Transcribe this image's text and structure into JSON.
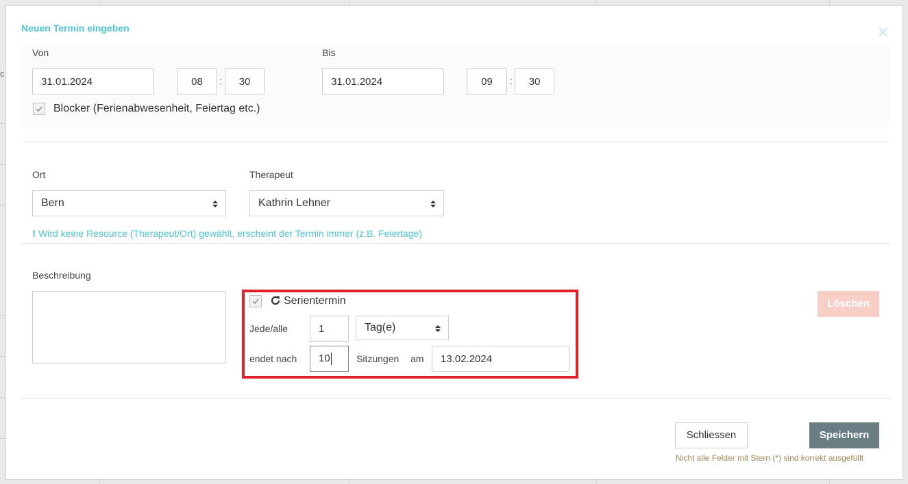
{
  "backdrop": {
    "glyph": "c"
  },
  "modal": {
    "title": "Neuen Termin eingeben",
    "close_icon": "×",
    "von": {
      "label": "Von",
      "date": "31.01.2024",
      "hour": "08",
      "minute": "30",
      "colon": ":"
    },
    "bis": {
      "label": "Bis",
      "date": "31.01.2024",
      "hour": "09",
      "minute": "30",
      "colon": ":"
    },
    "blocker": {
      "checked": true,
      "label": "Blocker (Ferienabwesenheit, Feiertag etc.)"
    },
    "ort": {
      "label": "Ort",
      "value": "Bern"
    },
    "therapeut": {
      "label": "Therapeut",
      "value": "Kathrin Lehner"
    },
    "hint": {
      "mark": "!",
      "text": "Wird keine Resource (Therapeut/Ort) gewählt, erscheint der Termin immer (z.B. Feiertage)"
    },
    "beschreibung": {
      "label": "Beschreibung",
      "value": ""
    },
    "serie": {
      "checked": true,
      "title": "Serientermin",
      "jede_label": "Jede/alle",
      "interval": "1",
      "unit": "Tag(e)",
      "endet_label": "endet nach",
      "sessions": "10",
      "sitzungen_label": "Sitzungen",
      "am_label": "am",
      "end_date": "13.02.2024"
    },
    "buttons": {
      "delete": "Löschen",
      "close": "Schliessen",
      "save": "Speichern"
    },
    "footer_note": "Nicht alle Felder mit Stern (*) sind korrekt ausgefüllt"
  },
  "colors": {
    "accent": "#4ec3d6",
    "highlight_border": "#e0202a",
    "save_button": "#6a7d82",
    "delete_button": "#f8cfc6",
    "warning_text": "#a08a55"
  }
}
